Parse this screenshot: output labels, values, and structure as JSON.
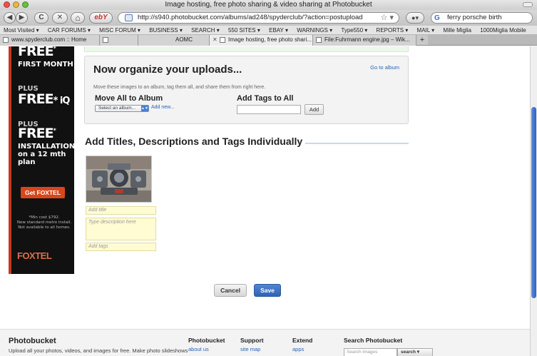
{
  "window": {
    "title": "Image hosting, free photo sharing & video sharing at Photobucket"
  },
  "nav": {
    "url": "http://s940.photobucket.com/albums/ad248/spyderclub/?action=postupload",
    "search_value": "ferry porsche birth",
    "back_glyph": "◀",
    "forward_glyph": "▶",
    "reload_glyph": "C",
    "stop_glyph": "✕",
    "home_glyph": "⌂",
    "ebay_label": "ebY"
  },
  "bookmarks": [
    "Most Visited ▾",
    "CAR FORUMS ▾",
    "MISC FORUM ▾",
    "BUSINESS ▾",
    "SEARCH ▾",
    "550 SITES ▾",
    "EBAY ▾",
    "WARNINGS ▾",
    "Type550 ▾",
    "REPORTS ▾",
    "MAIL ▾",
    "Mille Miglia",
    "1000Miglia Mobile"
  ],
  "tabs": [
    {
      "label": "www.spyderclub.com :: Home"
    },
    {
      "label": ""
    },
    {
      "label": "AOMC"
    },
    {
      "label": "Image hosting, free photo shari..."
    },
    {
      "label": "File:Fuhrmann engine.jpg – Wik..."
    }
  ],
  "ad": {
    "line1": "FREE",
    "line1_sup": "*",
    "line2": "FIRST MONTH",
    "line3": "PLUS",
    "line4": "FREE",
    "line4_suffix": "* iQ",
    "line5": "PLUS",
    "line6": "FREE",
    "line6_sup": "*",
    "line7": "INSTALLATION",
    "line8": "on a 12 mth",
    "line9": "plan",
    "cta": "Get FOXTEL",
    "fine1": "*Min cost $792.",
    "fine2": "New standard metro install.",
    "fine3": "Not available to all homes.",
    "logo": "FOXTEL"
  },
  "organize": {
    "title": "Now organize your uploads...",
    "goto_link": "Go to album",
    "description": "Move these images to an album, tag them all, and share them from right here.",
    "move_label": "Move All to Album",
    "album_select": "Select an album...",
    "add_new": "Add new...",
    "tags_label": "Add Tags to All",
    "tags_add": "Add"
  },
  "individual": {
    "title": "Add Titles, Descriptions and Tags Individually",
    "title_placeholder": "Add title",
    "desc_placeholder": "Type description here",
    "tags_placeholder": "Add tags"
  },
  "actions": {
    "cancel": "Cancel",
    "save": "Save"
  },
  "footer": {
    "brand": "Photobucket",
    "tagline": "Upload all your photos, videos, and images for free. Make photo slideshows",
    "col1_title": "Photobucket",
    "col1_link": "about us",
    "col2_title": "Support",
    "col2_link": "site map",
    "col3_title": "Extend",
    "col3_link": "apps",
    "search_title": "Search Photobucket",
    "search_placeholder": "Search images",
    "search_button": "search ▾"
  }
}
